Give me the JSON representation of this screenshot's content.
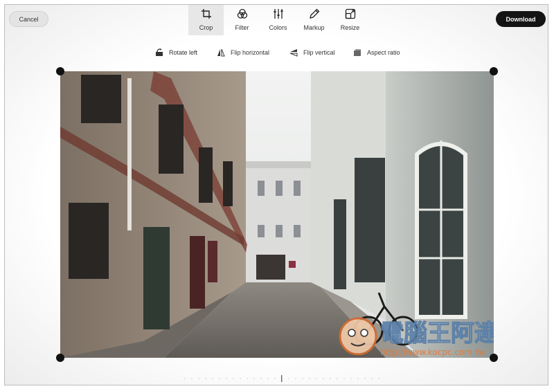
{
  "header": {
    "cancel_label": "Cancel",
    "download_label": "Download",
    "tabs": [
      {
        "label": "Crop",
        "icon": "crop-icon",
        "active": true
      },
      {
        "label": "Filter",
        "icon": "filter-icon",
        "active": false
      },
      {
        "label": "Colors",
        "icon": "sliders-icon",
        "active": false
      },
      {
        "label": "Markup",
        "icon": "pen-icon",
        "active": false
      },
      {
        "label": "Resize",
        "icon": "resize-icon",
        "active": false
      }
    ]
  },
  "crop_tools": [
    {
      "label": "Rotate left",
      "icon": "rotate-left-icon"
    },
    {
      "label": "Flip horizontal",
      "icon": "flip-horizontal-icon"
    },
    {
      "label": "Flip vertical",
      "icon": "flip-vertical-icon"
    },
    {
      "label": "Aspect ratio",
      "icon": "aspect-ratio-icon"
    }
  ],
  "watermark": {
    "title": "電腦王阿達",
    "url": "http://www.kocpc.com.tw"
  },
  "colors": {
    "active_tab_bg": "#e7e7e7",
    "download_bg": "#141414",
    "handle": "#111111"
  }
}
